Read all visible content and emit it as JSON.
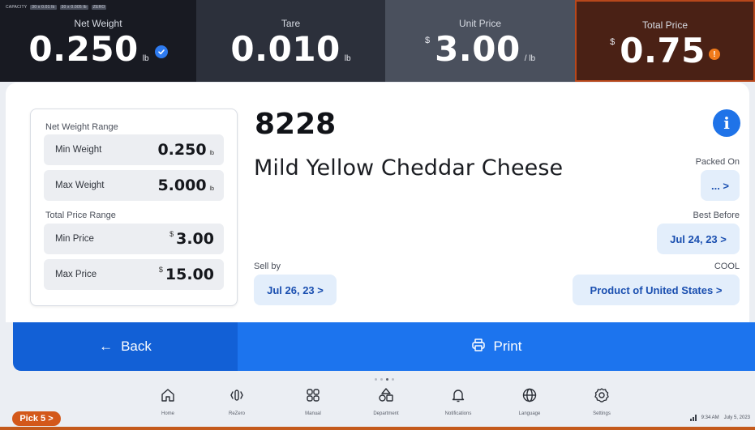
{
  "capacity": {
    "label": "CAPACITY",
    "range1": "30 x 0.01 lb",
    "range2": "30 x 0.005 lb",
    "zero": "ZERO"
  },
  "metrics": {
    "net_weight": {
      "label": "Net Weight",
      "value": "0.250",
      "unit": "lb"
    },
    "tare": {
      "label": "Tare",
      "value": "0.010",
      "unit": "lb"
    },
    "unit_price": {
      "label": "Unit Price",
      "currency": "$",
      "value": "3.00",
      "unit": "/ lb"
    },
    "total_price": {
      "label": "Total Price",
      "currency": "$",
      "value": "0.75"
    }
  },
  "ranges": {
    "net_weight_title": "Net Weight Range",
    "min_weight": {
      "label": "Min Weight",
      "value": "0.250",
      "unit": "lb"
    },
    "max_weight": {
      "label": "Max Weight",
      "value": "5.000",
      "unit": "lb"
    },
    "total_price_title": "Total Price Range",
    "min_price": {
      "label": "Min Price",
      "currency": "$",
      "value": "3.00"
    },
    "max_price": {
      "label": "Max Price",
      "currency": "$",
      "value": "15.00"
    }
  },
  "product": {
    "plu": "8228",
    "name": "Mild Yellow Cheddar Cheese"
  },
  "fields": {
    "packed_on": {
      "label": "Packed On",
      "value": "... >"
    },
    "best_before": {
      "label": "Best Before",
      "value": "Jul 24, 23 >"
    },
    "sell_by": {
      "label": "Sell by",
      "value": "Jul 26, 23 >"
    },
    "cool": {
      "label": "COOL",
      "value": "Product of United States >"
    }
  },
  "actions": {
    "back": "Back",
    "print": "Print"
  },
  "nav": [
    {
      "label": "Home",
      "icon": "home-icon"
    },
    {
      "label": "ReZero",
      "icon": "rezero-icon"
    },
    {
      "label": "Manual",
      "icon": "grid-icon"
    },
    {
      "label": "Department",
      "icon": "department-icon"
    },
    {
      "label": "Notifications",
      "icon": "bell-icon"
    },
    {
      "label": "Language",
      "icon": "globe-icon"
    },
    {
      "label": "Settings",
      "icon": "gear-icon"
    }
  ],
  "pick": "Pick 5 >",
  "status": {
    "time": "9:34 AM",
    "date": "July 5, 2023"
  },
  "colors": {
    "accent_blue": "#1c74ee",
    "back_blue": "#1260d6",
    "warning_orange": "#f07a1a",
    "total_border": "#b8471b",
    "chip_bg": "#e3eefb"
  }
}
